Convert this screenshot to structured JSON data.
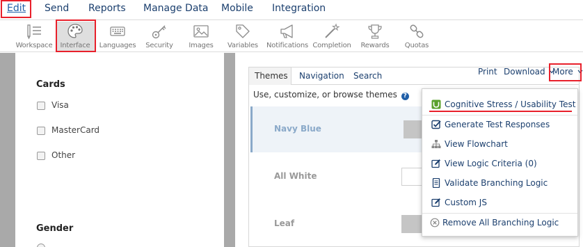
{
  "menu": {
    "edit": "Edit",
    "send": "Send",
    "reports": "Reports",
    "manage_data": "Manage Data",
    "mobile": "Mobile",
    "integration": "Integration"
  },
  "toolbar": {
    "items": [
      {
        "label": "Workspace",
        "icon": "workspace-icon"
      },
      {
        "label": "Interface",
        "icon": "palette-icon"
      },
      {
        "label": "Languages",
        "icon": "keyboard-icon"
      },
      {
        "label": "Security",
        "icon": "key-icon"
      },
      {
        "label": "Images",
        "icon": "image-icon"
      },
      {
        "label": "Variables",
        "icon": "tag-icon"
      },
      {
        "label": "Notifications",
        "icon": "megaphone-icon"
      },
      {
        "label": "Completion",
        "icon": "magic-wand-icon"
      },
      {
        "label": "Rewards",
        "icon": "trophy-icon"
      },
      {
        "label": "Quotas",
        "icon": "chain-link-icon"
      }
    ],
    "active": "Interface"
  },
  "survey": {
    "cards_title": "Cards",
    "cards_options": [
      "Visa",
      "MasterCard",
      "Other"
    ],
    "gender_title": "Gender"
  },
  "panel": {
    "tabs": [
      "Themes",
      "Navigation",
      "Search"
    ],
    "selected_tab": "Themes",
    "actions": {
      "print": "Print",
      "download": "Download",
      "more": "More"
    },
    "subtitle": "Use, customize, or browse themes",
    "help_glyph": "?",
    "themes": [
      {
        "name": "Navy Blue",
        "swatch": "#c5c5c5"
      },
      {
        "name": "All White",
        "swatch": "#ffffff"
      },
      {
        "name": "Leaf",
        "swatch": "#c5c5c5"
      }
    ]
  },
  "more_menu": {
    "items": [
      {
        "label": "Cognitive Stress / Usability Test",
        "icon": "usability-test-icon",
        "color": "#5aa02c"
      },
      {
        "label": "Generate Test Responses",
        "icon": "checkbox-icon"
      },
      {
        "label": "View Flowchart",
        "icon": "sitemap-icon"
      },
      {
        "label": "View Logic Criteria (0)",
        "icon": "edit-icon"
      },
      {
        "label": "Validate Branching Logic",
        "icon": "document-icon"
      },
      {
        "label": "Custom JS",
        "icon": "edit-icon"
      },
      {
        "label": "Remove All Branching Logic",
        "icon": "remove-circle-icon"
      }
    ]
  },
  "colors": {
    "accent": "#1b3f6e",
    "highlight": "#e8202b",
    "separator_grey": "#a9a9a9"
  }
}
